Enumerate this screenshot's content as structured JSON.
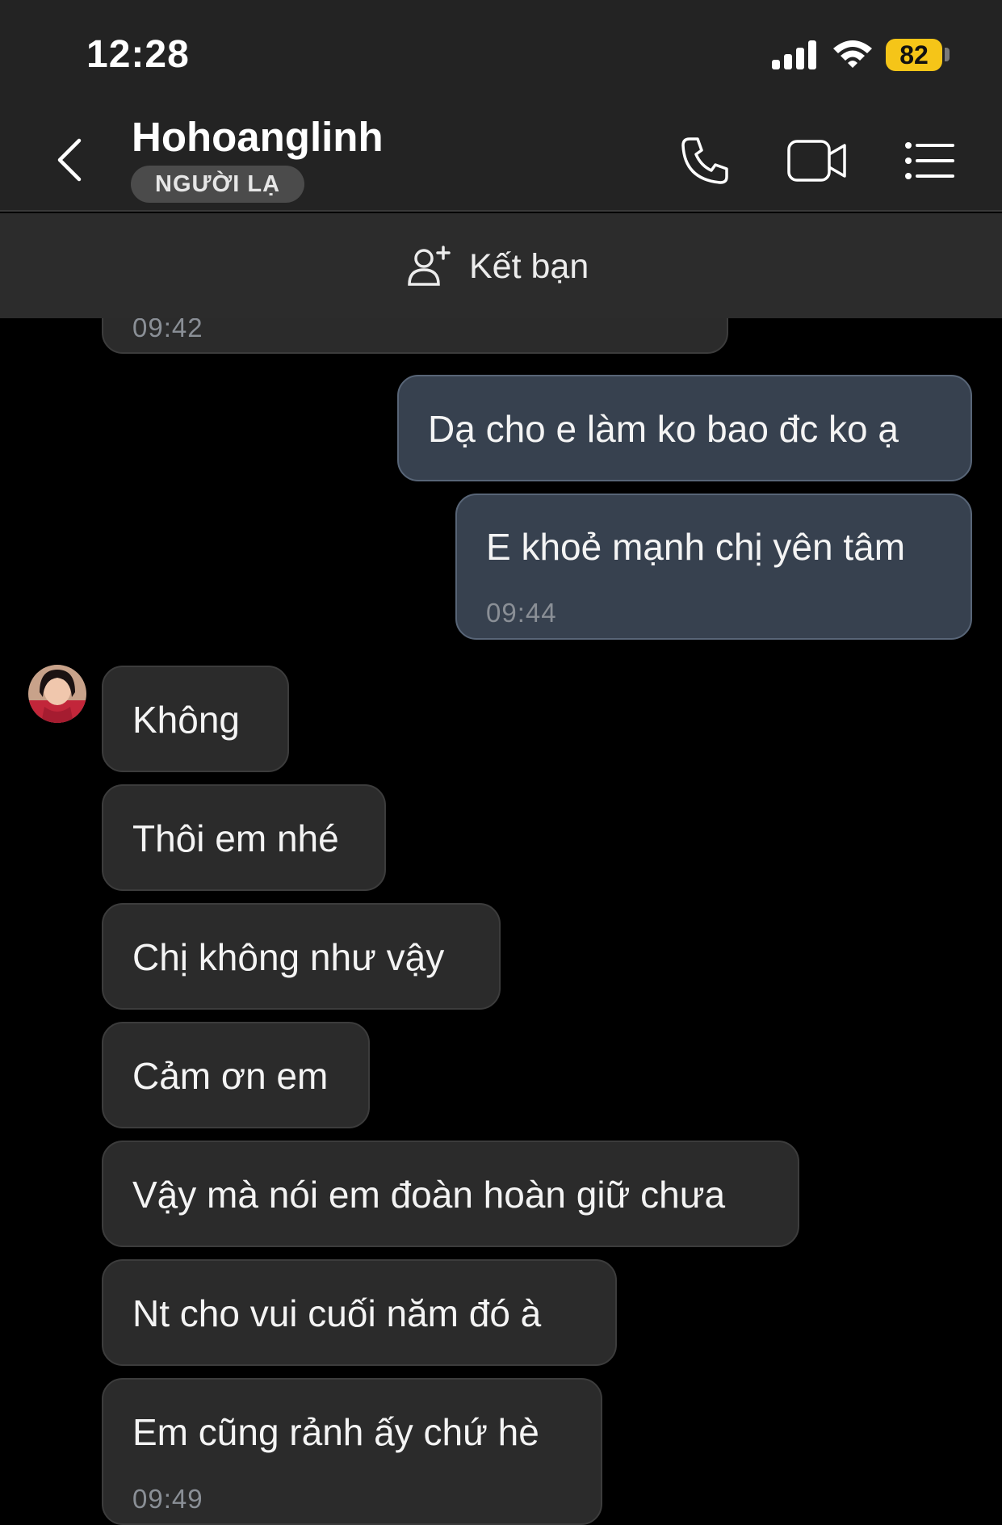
{
  "status_bar": {
    "time": "12:28",
    "battery": "82",
    "signal_bars": 4,
    "battery_color": "#f5c518"
  },
  "header": {
    "contact_name": "Hohoanglinh",
    "badge": "NGƯỜI LẠ",
    "icons": [
      "back-chevron-icon",
      "phone-icon",
      "video-call-icon",
      "menu-list-icon"
    ]
  },
  "friend_bar": {
    "label": "Kết bạn",
    "icon": "add-friend-icon"
  },
  "messages": [
    {
      "direction": "in",
      "text": "",
      "time": "09:42",
      "cut_off": true
    },
    {
      "direction": "out",
      "text": "Dạ cho e làm ko bao đc ko ạ",
      "time": ""
    },
    {
      "direction": "out",
      "text": "E khoẻ mạnh chị yên tâm",
      "time": "09:44"
    },
    {
      "direction": "in",
      "text": "Không",
      "time": ""
    },
    {
      "direction": "in",
      "text": "Thôi em nhé",
      "time": ""
    },
    {
      "direction": "in",
      "text": "Chị không như vậy",
      "time": ""
    },
    {
      "direction": "in",
      "text": "Cảm ơn em",
      "time": ""
    },
    {
      "direction": "in",
      "text": "Vậy mà nói em đoàn hoàn giữ chưa",
      "time": ""
    },
    {
      "direction": "in",
      "text": "Nt cho vui cuối năm đó à",
      "time": ""
    },
    {
      "direction": "in",
      "text": "Em cũng rảnh ấy chứ hè",
      "time": "09:49"
    }
  ],
  "colors": {
    "background": "#000000",
    "header_bg": "#232323",
    "incoming_bubble": "#2b2b2b",
    "outgoing_bubble": "#37414f",
    "timestamp": "#8a8f96"
  }
}
